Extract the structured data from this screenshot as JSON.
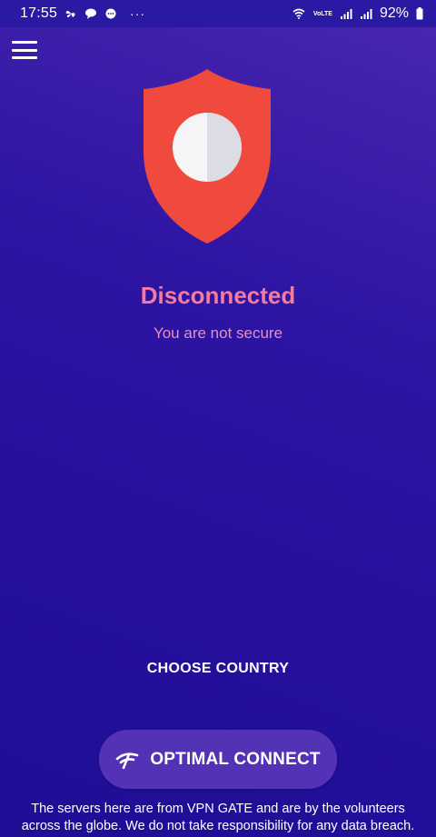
{
  "status_bar": {
    "time": "17:55",
    "lte_label": "VoLTE",
    "battery_percent": "92%",
    "more_indicator": "···",
    "icons": [
      "fan-icon",
      "chat-bubble-icon",
      "message-icon",
      "wifi-icon",
      "signal-icon",
      "signal-icon",
      "battery-icon"
    ]
  },
  "header": {
    "menu_icon": "hamburger-menu-icon"
  },
  "connection": {
    "shield_icon": "shield-icon",
    "title": "Disconnected",
    "subtitle": "You are not secure",
    "colors": {
      "shield": "#f0493e",
      "shield_highlight": "#e8e8ee",
      "title": "#f47a9e",
      "subtitle": "#e890b8"
    }
  },
  "actions": {
    "choose_country_label": "CHOOSE COUNTRY",
    "optimal_connect_label": "OPTIMAL CONNECT",
    "optimal_connect_icon": "wifi-signal-icon"
  },
  "footer": {
    "disclaimer_line1": "The servers here are from VPN GATE and are by the volunteers",
    "disclaimer_line2": "across the globe. We do not take responsibility for any data breach."
  },
  "theme": {
    "background_top": "#4a27b0",
    "background_bottom": "#1f0e96",
    "button_bg": "#5432b6"
  }
}
